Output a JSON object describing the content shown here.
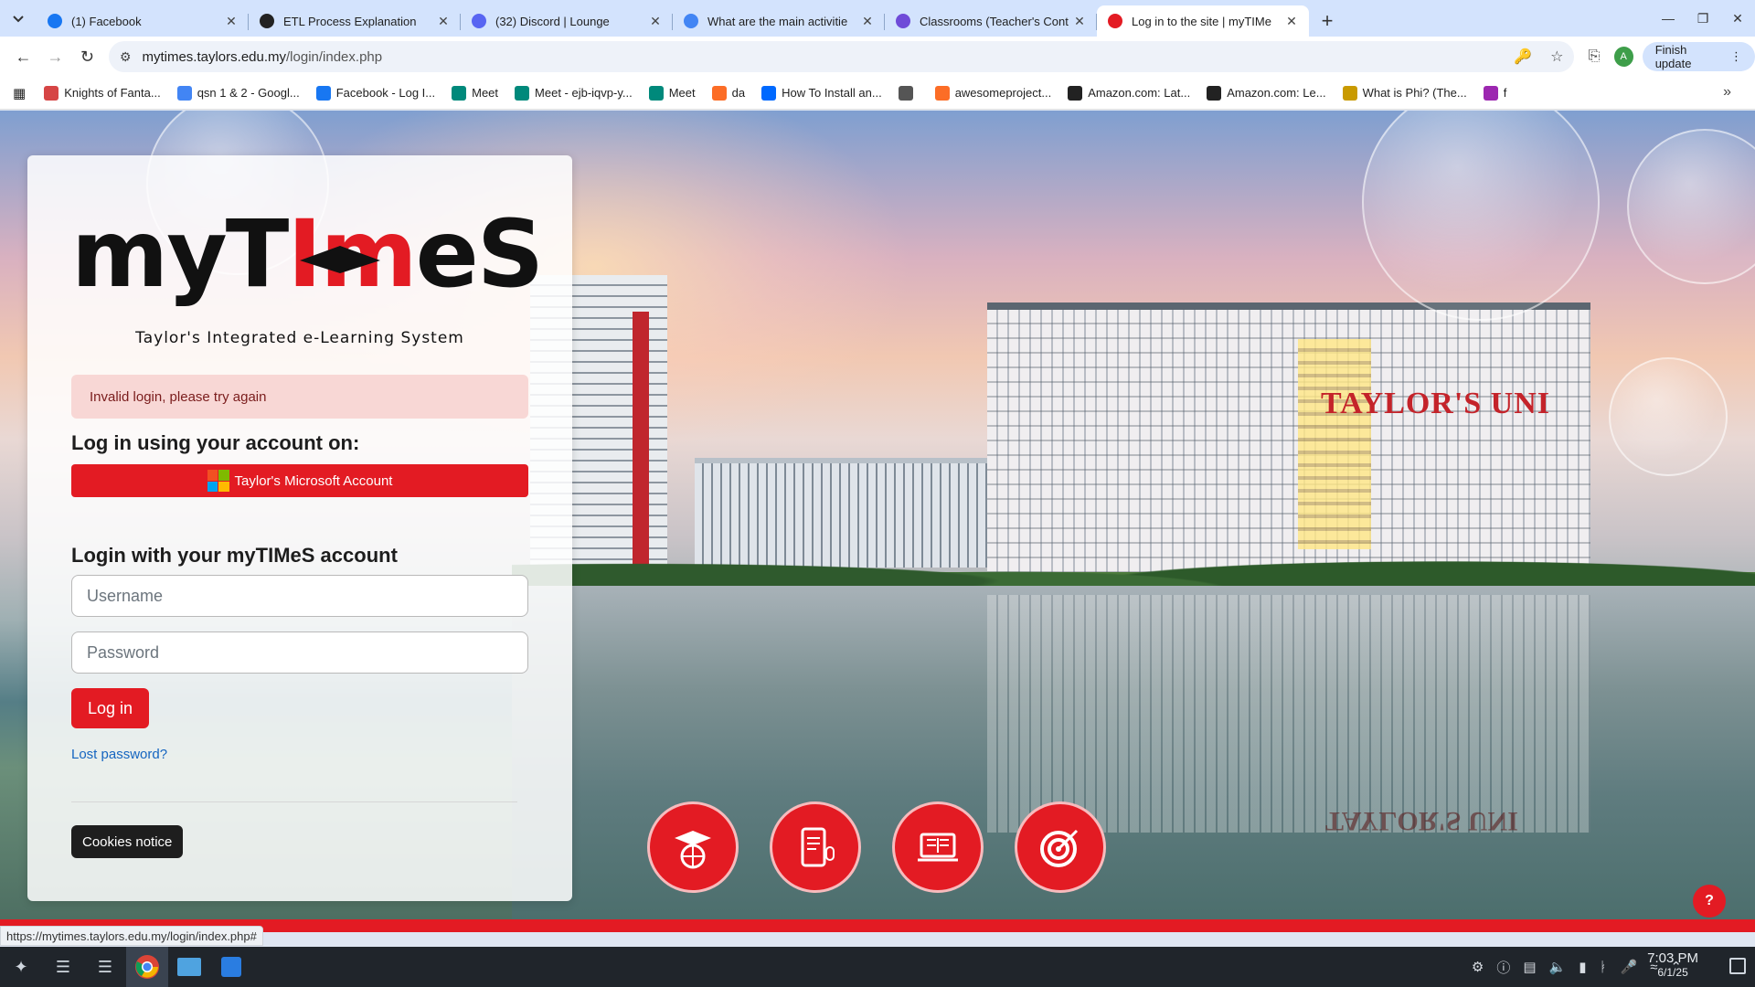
{
  "browser": {
    "tabs": [
      {
        "title": "(1) Facebook",
        "icon": "facebook-icon",
        "color": "#1877f2",
        "active": false
      },
      {
        "title": "ETL Process Explanation",
        "icon": "openai-icon",
        "color": "#222222",
        "active": false
      },
      {
        "title": "(32) Discord | Lounge",
        "icon": "discord-icon",
        "color": "#5865f2",
        "active": false
      },
      {
        "title": "What are the main activitie",
        "icon": "google-icon",
        "color": "#4285f4",
        "active": false
      },
      {
        "title": "Classrooms (Teacher's Cont",
        "icon": "classroom-icon",
        "color": "#6f4bd8",
        "active": false
      },
      {
        "title": "Log in to the site | myTIMe",
        "icon": "mytimes-icon",
        "color": "#e31b23",
        "active": true
      }
    ],
    "url_prefix": "mytimes.taylors.edu.my",
    "url_path": "/login/index.php",
    "finish_update": "Finish update",
    "profile_initial": "A",
    "bookmarks": [
      {
        "label": "Knights of Fanta...",
        "icon": "bookmark-knights-icon",
        "color": "#d64545"
      },
      {
        "label": "qsn 1 & 2 - Googl...",
        "icon": "google-docs-icon",
        "color": "#4285f4"
      },
      {
        "label": "Facebook - Log I...",
        "icon": "facebook-icon",
        "color": "#1877f2"
      },
      {
        "label": "Meet",
        "icon": "google-meet-icon",
        "color": "#00897b"
      },
      {
        "label": "Meet - ejb-iqvp-y...",
        "icon": "google-meet-icon",
        "color": "#00897b"
      },
      {
        "label": "Meet",
        "icon": "google-meet-icon",
        "color": "#00897b"
      },
      {
        "label": "da",
        "icon": "gitlab-icon",
        "color": "#fc6d26"
      },
      {
        "label": "How To Install an...",
        "icon": "digitalocean-icon",
        "color": "#0069ff"
      },
      {
        "label": "",
        "icon": "globe-icon",
        "color": "#555555"
      },
      {
        "label": "awesomeproject...",
        "icon": "gitlab-icon",
        "color": "#fc6d26"
      },
      {
        "label": "Amazon.com: Lat...",
        "icon": "amazon-icon",
        "color": "#222222"
      },
      {
        "label": "Amazon.com: Le...",
        "icon": "amazon-icon",
        "color": "#222222"
      },
      {
        "label": "What is Phi? (The...",
        "icon": "phi-icon",
        "color": "#c99a00"
      },
      {
        "label": "f",
        "icon": "circle-icon",
        "color": "#9c27b0"
      }
    ]
  },
  "page": {
    "logo": {
      "part1": "myT",
      "part2": "I",
      "part3": "m",
      "part4": "eS"
    },
    "tagline": "Taylor's Integrated e-Learning System",
    "alert": "Invalid login, please try again",
    "login_using": "Log in using your account on:",
    "ms_button": "Taylor's Microsoft Account",
    "login_with": "Login with your myTIMeS account",
    "username_placeholder": "Username",
    "password_placeholder": "Password",
    "login_button": "Log in",
    "lost_password": "Lost password?",
    "cookies": "Cookies notice",
    "building_sign": "TAYLOR'S UNI",
    "help": "?",
    "accent": "#e31b23"
  },
  "status_url": "https://mytimes.taylors.edu.my/login/index.php#",
  "taskbar": {
    "time": "7:03 PM",
    "date": "6/1/25"
  }
}
